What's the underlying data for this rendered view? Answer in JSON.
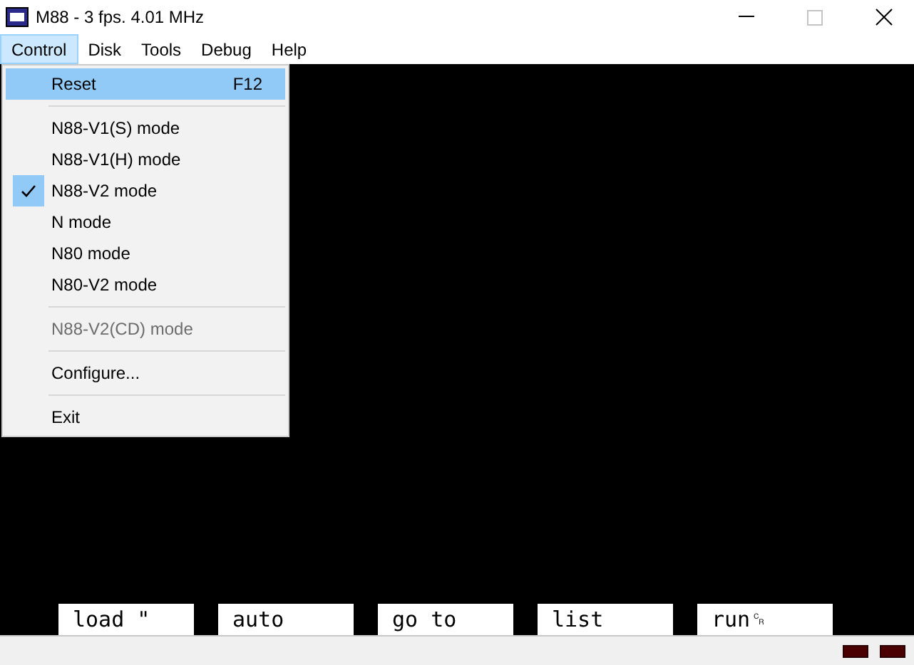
{
  "window": {
    "title": "M88 - 3 fps.  4.01 MHz"
  },
  "menu_bar": [
    {
      "label": "Control",
      "selected": true
    },
    {
      "label": "Disk",
      "selected": false
    },
    {
      "label": "Tools",
      "selected": false
    },
    {
      "label": "Debug",
      "selected": false
    },
    {
      "label": "Help",
      "selected": false
    }
  ],
  "menu": [
    {
      "kind": "item",
      "label": "Reset",
      "shortcut": "F12",
      "selected": true,
      "checked": false,
      "disabled": false
    },
    {
      "kind": "separator"
    },
    {
      "kind": "item",
      "label": "N88-V1(S) mode",
      "selected": false,
      "checked": false,
      "disabled": false
    },
    {
      "kind": "item",
      "label": "N88-V1(H) mode",
      "selected": false,
      "checked": false,
      "disabled": false
    },
    {
      "kind": "item",
      "label": "N88-V2 mode",
      "selected": false,
      "checked": true,
      "disabled": false
    },
    {
      "kind": "item",
      "label": "N mode",
      "selected": false,
      "checked": false,
      "disabled": false
    },
    {
      "kind": "item",
      "label": "N80 mode",
      "selected": false,
      "checked": false,
      "disabled": false
    },
    {
      "kind": "item",
      "label": "N80-V2 mode",
      "selected": false,
      "checked": false,
      "disabled": false
    },
    {
      "kind": "separator"
    },
    {
      "kind": "item",
      "label": "N88-V2(CD) mode",
      "selected": false,
      "checked": false,
      "disabled": true
    },
    {
      "kind": "separator"
    },
    {
      "kind": "item",
      "label": "Configure...",
      "selected": false,
      "checked": false,
      "disabled": false
    },
    {
      "kind": "separator"
    },
    {
      "kind": "item",
      "label": "Exit",
      "selected": false,
      "checked": false,
      "disabled": false
    }
  ],
  "function_keys": [
    "load \"",
    "auto",
    "go to",
    "list",
    "run␍"
  ]
}
